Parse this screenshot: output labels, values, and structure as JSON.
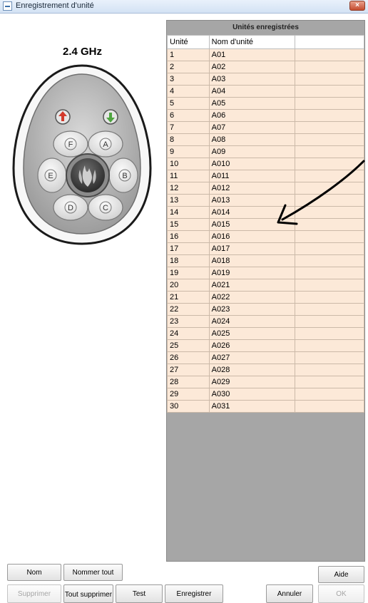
{
  "window": {
    "title": "Enregistrement d'unité",
    "close_symbol": "×"
  },
  "left_panel": {
    "frequency": "2.4 GHz",
    "remote": {
      "buttons": [
        "F",
        "A",
        "B",
        "C",
        "D",
        "E"
      ],
      "top_left_icon": "red-flame-icon",
      "top_right_icon": "green-flame-icon",
      "center_icon": "flame-logo-icon"
    }
  },
  "table": {
    "title": "Unités enregistrées",
    "headers": [
      "Unité",
      "Nom d'unité",
      ""
    ],
    "rows": [
      [
        "1",
        "A01"
      ],
      [
        "2",
        "A02"
      ],
      [
        "3",
        "A03"
      ],
      [
        "4",
        "A04"
      ],
      [
        "5",
        "A05"
      ],
      [
        "6",
        "A06"
      ],
      [
        "7",
        "A07"
      ],
      [
        "8",
        "A08"
      ],
      [
        "9",
        "A09"
      ],
      [
        "10",
        "A010"
      ],
      [
        "11",
        "A011"
      ],
      [
        "12",
        "A012"
      ],
      [
        "13",
        "A013"
      ],
      [
        "14",
        "A014"
      ],
      [
        "15",
        "A015"
      ],
      [
        "16",
        "A016"
      ],
      [
        "17",
        "A017"
      ],
      [
        "18",
        "A018"
      ],
      [
        "19",
        "A019"
      ],
      [
        "20",
        "A021"
      ],
      [
        "21",
        "A022"
      ],
      [
        "22",
        "A023"
      ],
      [
        "23",
        "A024"
      ],
      [
        "24",
        "A025"
      ],
      [
        "25",
        "A026"
      ],
      [
        "26",
        "A027"
      ],
      [
        "27",
        "A028"
      ],
      [
        "28",
        "A029"
      ],
      [
        "29",
        "A030"
      ],
      [
        "30",
        "A031"
      ]
    ]
  },
  "buttons": {
    "nom": "Nom",
    "nommer_tout": "Nommer tout",
    "aide": "Aide",
    "supprimer": "Supprimer",
    "tout_supprimer": "Tout supprimer",
    "test": "Test",
    "enregistrer": "Enregistrer",
    "annuler": "Annuler",
    "ok": "OK"
  }
}
